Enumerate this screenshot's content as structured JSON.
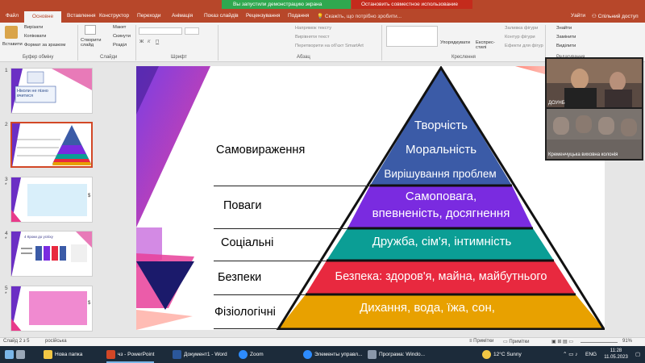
{
  "banner": {
    "sharing": "Вы запустили демонстрацию экрана",
    "stop": "Остановить совместное использование"
  },
  "menu": {
    "file": "Файл",
    "home": "Основне",
    "insert": "Вставлення",
    "design": "Конструктор",
    "transitions": "Переходи",
    "animations": "Анімація",
    "slideshow": "Показ слайдів",
    "review": "Рецензування",
    "view": "Подання",
    "tellme": "Скажіть, що потрібно зробити...",
    "signin": "Уайти",
    "share": "Спільний доступ"
  },
  "ribbon": {
    "paste": "Вставити",
    "cut": "Вирізати",
    "copy": "Копіювати",
    "format_painter": "Формат за зразком",
    "clipboard": "Буфер обміну",
    "new_slide": "Створити слайд",
    "layout": "Макет",
    "reset": "Скинути",
    "section": "Розділ",
    "slides": "Слайди",
    "font": "Шрифт",
    "paragraph": "Абзац",
    "text_direction": "Напрямок тексту",
    "align_text": "Вирівняти текст",
    "smartart": "Перетворити на об'єкт SmartArt",
    "arrange": "Упорядкувати",
    "quick_styles": "Експрес-стилі",
    "fill": "Заливка фігури",
    "outline": "Контур фігури",
    "effects": "Ефекти для фігур",
    "drawing": "Креслення",
    "find": "Знайти",
    "replace": "Замінити",
    "select": "Виділити",
    "editing": "Редагування"
  },
  "thumbnails": [
    {
      "num": "1",
      "text": "Ніколи не пізно вчитися",
      "star": ""
    },
    {
      "num": "2",
      "text": "",
      "star": ""
    },
    {
      "num": "3",
      "text": "",
      "star": "*"
    },
    {
      "num": "4",
      "text": "4 Кроки до успіху",
      "star": "*"
    },
    {
      "num": "5",
      "text": "",
      "star": "*"
    }
  ],
  "slide": {
    "levels": [
      "Самовираження",
      "Поваги",
      "Соціальні",
      "Безпеки",
      "Фізіологічні"
    ],
    "pyramid": {
      "top": [
        "Творчість",
        "Моральність",
        "Вирішування проблем"
      ],
      "esteem": [
        "Самоповага,",
        "впевненість, досягнення"
      ],
      "social": "Дружба, сім'я, інтимність",
      "safety": "Безпека: здоров'я, майна, майбутнього",
      "physio": "Дихання, вода, їжа, сон,"
    },
    "colors": {
      "top": "#3b5ba7",
      "esteem": "#7a2be0",
      "social": "#0b9e95",
      "safety": "#e8293f",
      "physio": "#e8a100"
    }
  },
  "video": {
    "participant1": "ДОУНБ",
    "participant2": "Кременчуцька виховна колонія"
  },
  "status": {
    "slide": "Слайд 2 з 5",
    "lang": "російська",
    "notes": "Примітки",
    "comments": "Примітки",
    "zoom": "91%"
  },
  "taskbar": {
    "folder": "Нова папка",
    "ppt": "чз - PowerPoint",
    "word": "Документ1 - Word",
    "zoom": "Zoom",
    "zoom2": "Элементы управл...",
    "program": "Програма: Windo...",
    "weather": "12°C  Sunny",
    "lang": "ENG",
    "time": "11:28",
    "date": "11.05.2023"
  }
}
